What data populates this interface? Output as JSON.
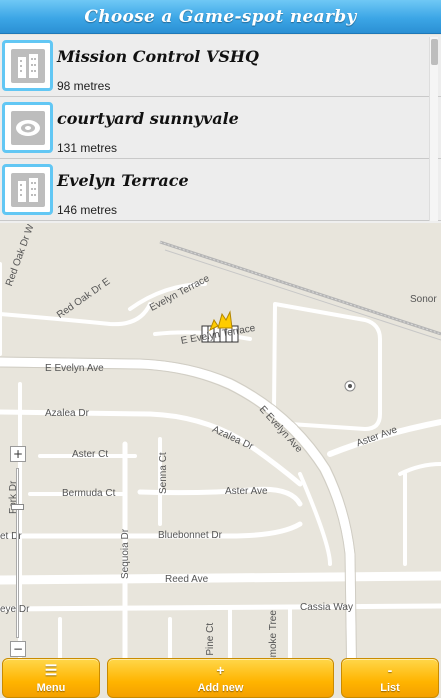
{
  "header": {
    "title": "Choose a Game-spot nearby"
  },
  "list": {
    "items": [
      {
        "title": "Mission Control VSHQ",
        "distance": "98 metres",
        "icon": "building-icon"
      },
      {
        "title": "courtyard sunnyvale",
        "distance": "131 metres",
        "icon": "stadium-icon"
      },
      {
        "title": "Evelyn Terrace",
        "distance": "146 metres",
        "icon": "building-icon"
      }
    ]
  },
  "map": {
    "labels": {
      "red_oak_dr_1": "Red Oak Dr W",
      "red_oak_dr_2": "Red Oak Dr E",
      "evelyn_terrace": "Evelyn Terrace",
      "e_evelyn_terrace": "E Evelyn Terrace",
      "e_evelyn_ave_1": "E Evelyn Ave",
      "e_evelyn_ave_2": "E Evelyn Ave",
      "sonor": "Sonor",
      "azalea_dr_1": "Azalea Dr",
      "azalea_dr_2": "Azalea Dr",
      "aster_ave_1": "Aster Ave",
      "aster_ave_2": "Aster Ave",
      "aster_ct": "Aster Ct",
      "senna_ct": "Senna Ct",
      "fork_dr": "Fork Dr",
      "bermuda_ct": "Bermuda Ct",
      "bluebonnet_dr_1": "Bluebonnet Dr",
      "bluebonnet_dr_2": "et Dr",
      "sequoia_dr": "Sequoia Dr",
      "reed_ave": "Reed Ave",
      "cassia_way": "Cassia Way",
      "eye_dr": "eye Dr",
      "ever_pine_ct": "Ever Pine Ct",
      "smoke_tree": "Smoke Tree"
    },
    "zoom_in": "+",
    "zoom_out": "−"
  },
  "bottom": {
    "menu": {
      "glyph": "☰",
      "label": "Menu"
    },
    "add": {
      "glyph": "+",
      "label": "Add new"
    },
    "list": {
      "glyph": "-",
      "label": "List"
    }
  }
}
